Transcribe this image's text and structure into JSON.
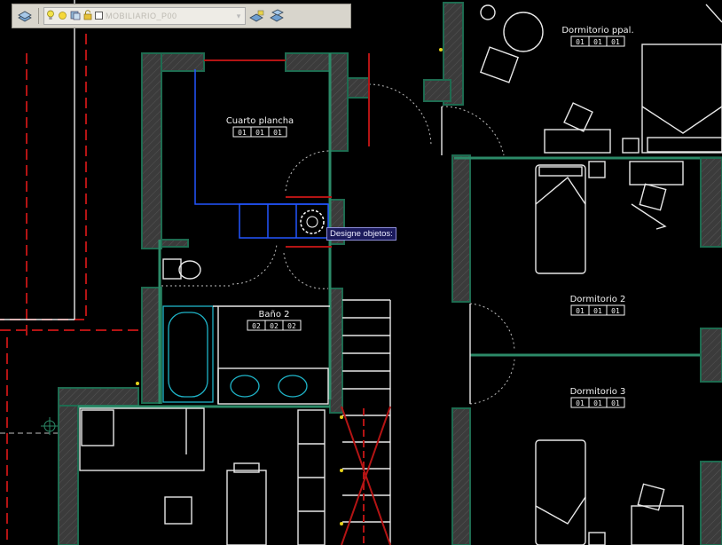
{
  "toolbar": {
    "layer_name": "MOBILIARIO_P00",
    "icons": [
      "layer-manager-icon",
      "lightbulb-icon",
      "sun-icon",
      "freeze-icon",
      "lock-icon",
      "color-swatch-icon",
      "make-current-icon",
      "layer-previous-icon"
    ]
  },
  "rooms": {
    "cuarto_plancha": {
      "name": "Cuarto plancha",
      "codes": [
        "01",
        "01",
        "01"
      ]
    },
    "bano_2": {
      "name": "Baño 2",
      "codes": [
        "02",
        "02",
        "02"
      ]
    },
    "dormitorio_ppal": {
      "name": "Dormitorio ppal.",
      "codes": [
        "01",
        "01",
        "01"
      ]
    },
    "dormitorio_2": {
      "name": "Dormitorio 2",
      "codes": [
        "01",
        "01",
        "01"
      ]
    },
    "dormitorio_3": {
      "name": "Dormitorio 3",
      "codes": [
        "01",
        "01",
        "01"
      ]
    }
  },
  "tooltip": {
    "text": "Designe objetos:"
  },
  "colors": {
    "background": "#000000",
    "wall_edge": "#1e6b50",
    "selection": "#2255ff",
    "fixture": "#1fb4c8",
    "axis": "#b41414"
  }
}
